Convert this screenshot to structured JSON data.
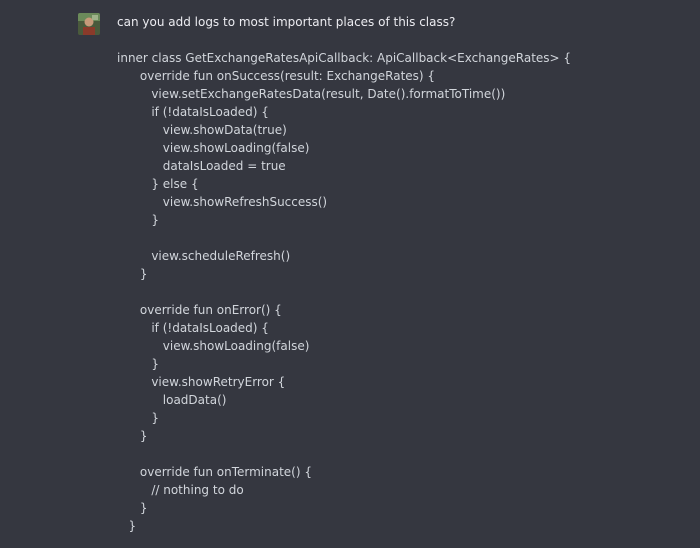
{
  "user_message": {
    "avatar": "user-avatar",
    "question": "can you add logs to most important places of this class?",
    "code_lines": [
      "inner class GetExchangeRatesApiCallback: ApiCallback<ExchangeRates> {",
      "      override fun onSuccess(result: ExchangeRates) {",
      "         view.setExchangeRatesData(result, Date().formatToTime())",
      "         if (!dataIsLoaded) {",
      "            view.showData(true)",
      "            view.showLoading(false)",
      "            dataIsLoaded = true",
      "         } else {",
      "            view.showRefreshSuccess()",
      "         }",
      "",
      "         view.scheduleRefresh()",
      "      }",
      "",
      "      override fun onError() {",
      "         if (!dataIsLoaded) {",
      "            view.showLoading(false)",
      "         }",
      "         view.showRetryError {",
      "            loadData()",
      "         }",
      "      }",
      "",
      "      override fun onTerminate() {",
      "         // nothing to do",
      "      }",
      "   }"
    ]
  }
}
